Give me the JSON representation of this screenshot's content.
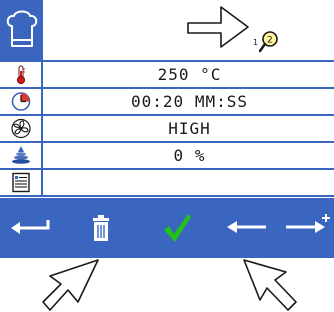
{
  "header": {
    "chef_icon": "chef-hat-icon",
    "steps_icon": "magnifier-steps-icon",
    "steps_label_1": "1",
    "steps_label_2": "2"
  },
  "rows": [
    {
      "icon": "thermometer-icon",
      "value": "250 °C"
    },
    {
      "icon": "clock-icon",
      "value": "00:20 MM:SS"
    },
    {
      "icon": "fan-icon",
      "value": "HIGH"
    },
    {
      "icon": "humidity-icon",
      "value": "0 %"
    },
    {
      "icon": "notes-icon",
      "value": ""
    }
  ],
  "toolbar": {
    "back_icon": "return-arrow-icon",
    "delete_icon": "trash-icon",
    "confirm_icon": "checkmark-icon",
    "previous_icon": "left-arrow-icon",
    "add_icon": "right-arrow-plus-icon"
  },
  "colors": {
    "accent": "#3a66c0",
    "confirm": "#22c01a"
  }
}
